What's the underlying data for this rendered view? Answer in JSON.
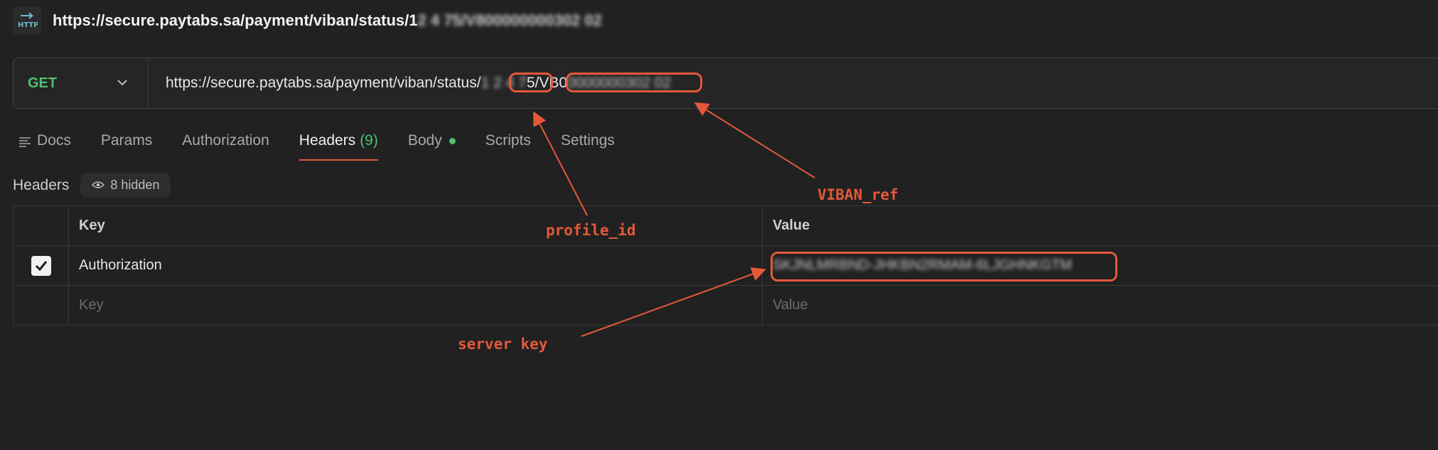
{
  "title": {
    "url_prefix": "https://secure.paytabs.sa/payment/viban/status/1",
    "url_blurred": "2 4 75/V800000000302 02"
  },
  "request": {
    "method": "GET",
    "url_prefix": "https://secure.paytabs.sa/payment/viban/status/",
    "profile_id_blurred": "1 2 4 7",
    "middle": "5/VB0",
    "viban_blurred": "0000000302 02"
  },
  "tabs": [
    {
      "label": "Docs"
    },
    {
      "label": "Params"
    },
    {
      "label": "Authorization"
    },
    {
      "label": "Headers",
      "count": "(9)"
    },
    {
      "label": "Body"
    },
    {
      "label": "Scripts"
    },
    {
      "label": "Settings"
    }
  ],
  "headers_section": {
    "label": "Headers",
    "hidden_badge": "8 hidden"
  },
  "table": {
    "columns": [
      "Key",
      "Value"
    ],
    "rows": [
      {
        "checked": true,
        "key": "Authorization",
        "value_blurred": "SKJNLMRBND-JHKBN2RMAM-6LJGHNKGTM"
      }
    ],
    "placeholder_key": "Key",
    "placeholder_value": "Value"
  },
  "annotations": {
    "profile_id": "profile_id",
    "viban_ref": "VIBAN_ref",
    "server_key": "server key"
  },
  "colors": {
    "accent": "#e4583a",
    "method_get": "#4fc071",
    "background": "#212121"
  },
  "icons": {
    "title": "http-request-icon",
    "method_dropdown": "chevron-down-icon",
    "docs": "docs-lines-icon",
    "hidden": "eye-icon",
    "check": "checkmark-icon"
  }
}
